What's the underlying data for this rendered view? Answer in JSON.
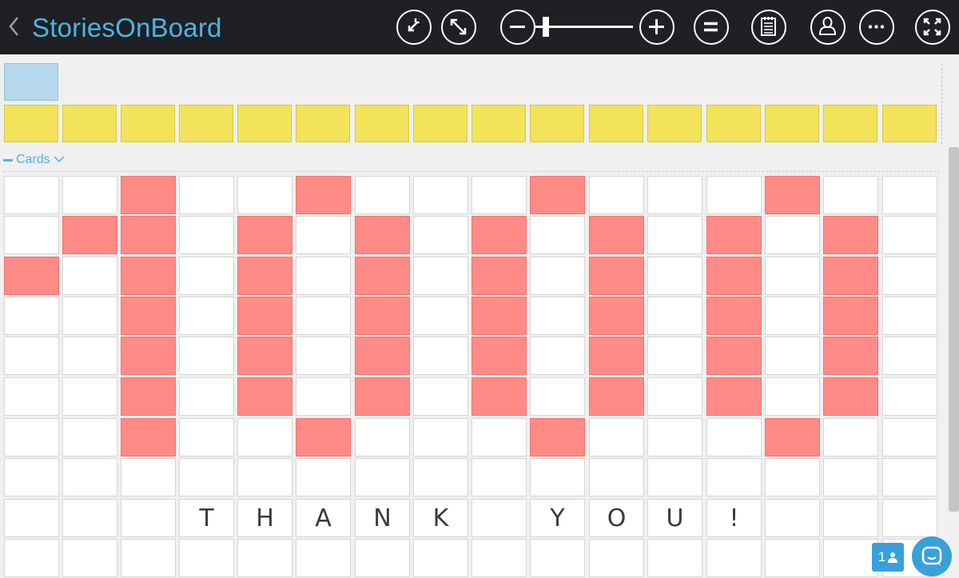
{
  "header": {
    "title": "StoriesOnBoard",
    "buttons": [
      {
        "name": "collapse-icon"
      },
      {
        "name": "expand-icon"
      },
      {
        "name": "zoom-out-icon"
      },
      {
        "name": "zoom-in-icon"
      },
      {
        "name": "menu-equal-icon"
      },
      {
        "name": "backlog-list-icon"
      },
      {
        "name": "user-profile-icon"
      },
      {
        "name": "more-options-icon"
      },
      {
        "name": "fullscreen-icon"
      }
    ],
    "zoom_level": 0.05
  },
  "board": {
    "section_label": "Cards",
    "users_online": "1",
    "colors": {
      "header_bg": "#1e2024",
      "accent": "#4fb3e4",
      "epic": "#b5d8ea",
      "feature": "#f3e35a",
      "highlight": "#ff8a86",
      "card": "#ffffff"
    },
    "grid": [
      [
        0,
        0,
        1,
        0,
        0,
        1,
        0,
        0,
        0,
        1,
        0,
        0,
        0,
        1,
        0,
        0
      ],
      [
        0,
        1,
        1,
        0,
        1,
        0,
        1,
        0,
        1,
        0,
        1,
        0,
        1,
        0,
        1,
        0
      ],
      [
        1,
        0,
        1,
        0,
        1,
        0,
        1,
        0,
        1,
        0,
        1,
        0,
        1,
        0,
        1,
        0
      ],
      [
        0,
        0,
        1,
        0,
        1,
        0,
        1,
        0,
        1,
        0,
        1,
        0,
        1,
        0,
        1,
        0
      ],
      [
        0,
        0,
        1,
        0,
        1,
        0,
        1,
        0,
        1,
        0,
        1,
        0,
        1,
        0,
        1,
        0
      ],
      [
        0,
        0,
        1,
        0,
        1,
        0,
        1,
        0,
        1,
        0,
        1,
        0,
        1,
        0,
        1,
        0
      ],
      [
        0,
        0,
        1,
        0,
        0,
        1,
        0,
        0,
        0,
        1,
        0,
        0,
        0,
        1,
        0,
        0
      ],
      [
        0,
        0,
        0,
        0,
        0,
        0,
        0,
        0,
        0,
        0,
        0,
        0,
        0,
        0,
        0,
        0
      ],
      [
        0,
        0,
        0,
        0,
        0,
        0,
        0,
        0,
        0,
        0,
        0,
        0,
        0,
        0,
        0,
        0
      ],
      [
        0,
        0,
        0,
        0,
        0,
        0,
        0,
        0,
        0,
        0,
        0,
        0,
        0,
        0,
        0,
        0
      ]
    ],
    "message_row": [
      "",
      "",
      "",
      "T",
      "H",
      "A",
      "N",
      "K",
      "",
      "Y",
      "O",
      "U",
      "!",
      "",
      "",
      ""
    ]
  }
}
